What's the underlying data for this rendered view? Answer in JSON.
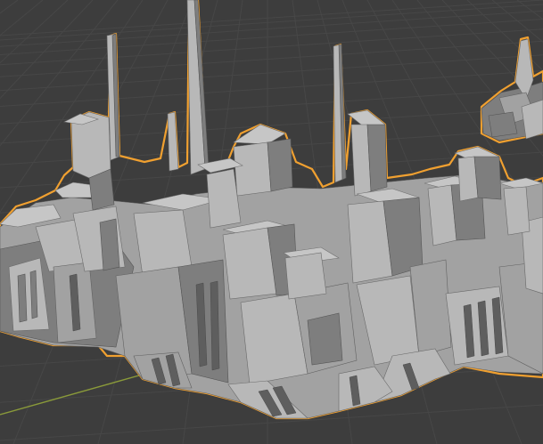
{
  "viewport": {
    "type": "3d-viewport",
    "background_color": "#3d3d3d",
    "grid_color": "#474747",
    "x_axis_color": "#8a9a3a",
    "selection_outline_color": "#f0a030",
    "object_shading_color": "#b0b0b0",
    "object_selected": true
  }
}
